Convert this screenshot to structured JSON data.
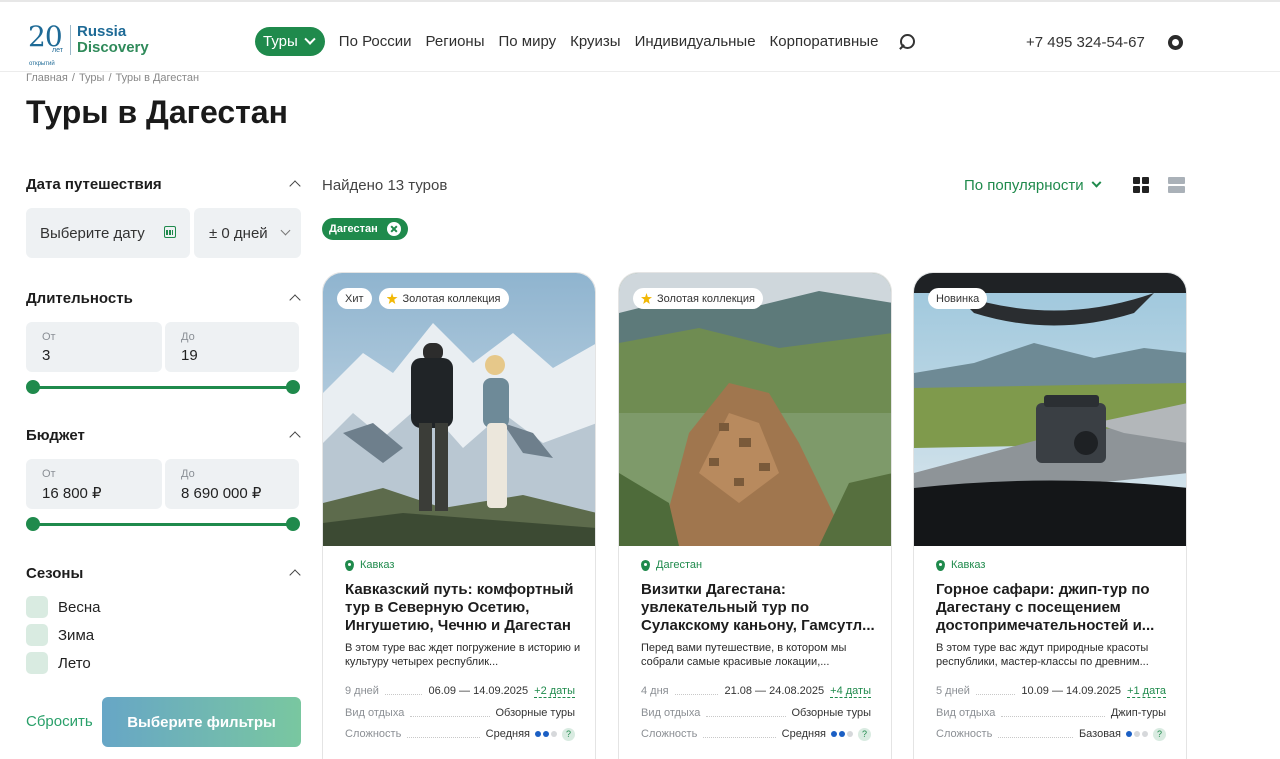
{
  "header": {
    "logo": {
      "years": "20",
      "years_word": "лет",
      "open_word": "открытий",
      "brand_line1": "Russia",
      "brand_line2": "Discovery"
    },
    "nav_primary": "Туры",
    "nav": [
      "По России",
      "Регионы",
      "По миру",
      "Круизы",
      "Индивидуальные",
      "Корпоративные"
    ],
    "phone": "+7 495 324-54-67"
  },
  "breadcrumb": [
    "Главная",
    "/",
    "Туры",
    "/",
    "Туры в Дагестан"
  ],
  "page_title": "Туры в Дагестан",
  "filters": {
    "date_title": "Дата путешествия",
    "date_placeholder": "Выберите дату",
    "days_value": "± 0 дней",
    "duration_title": "Длительность",
    "duration_from_label": "От",
    "duration_from": "3",
    "duration_to_label": "До",
    "duration_to": "19",
    "budget_title": "Бюджет",
    "budget_from_label": "От",
    "budget_from": "16 800 ₽",
    "budget_to_label": "До",
    "budget_to": "8 690 000 ₽",
    "seasons_title": "Сезоны",
    "seasons": [
      "Весна",
      "Зима",
      "Лето"
    ],
    "reset": "Сбросить",
    "apply": "Выберите фильтры"
  },
  "results": {
    "found": "Найдено 13 туров",
    "sort": "По популярности",
    "chip": "Дагестан"
  },
  "cards": [
    {
      "badges": [
        "Хит",
        "Золотая коллекция"
      ],
      "region": "Кавказ",
      "title": "Кавказский путь: комфортный тур в Северную Осетию, Ингушетию, Чечню и Дагестан",
      "desc": "В этом туре вас ждет погружение в историю и культуру четырех республик...",
      "duration": "9 дней",
      "dates": "06.09 — 14.09.2025",
      "more_dates": "+2 даты",
      "rest_label": "Вид отдыха",
      "rest": "Обзорные туры",
      "diff_label": "Сложность",
      "difficulty": "Средняя",
      "difficulty_level": 2
    },
    {
      "badges": [
        "Золотая коллекция"
      ],
      "region": "Дагестан",
      "title": "Визитки Дагестана: увлекательный тур по Сулакскому каньону, Гамсутл...",
      "desc": "Перед вами путешествие, в котором мы собрали самые красивые локации,...",
      "duration": "4 дня",
      "dates": "21.08 — 24.08.2025",
      "more_dates": "+4 даты",
      "rest_label": "Вид отдыха",
      "rest": "Обзорные туры",
      "diff_label": "Сложность",
      "difficulty": "Средняя",
      "difficulty_level": 2
    },
    {
      "badges": [
        "Новинка"
      ],
      "region": "Кавказ",
      "title": "Горное сафари: джип-тур по Дагестану с посещением достопримечательностей и...",
      "desc": "В этом туре вас ждут природные красоты республики, мастер-классы по древним...",
      "duration": "5 дней",
      "dates": "10.09 — 14.09.2025",
      "more_dates": "+1 дата",
      "rest_label": "Вид отдыха",
      "rest": "Джип-туры",
      "diff_label": "Сложность",
      "difficulty": "Базовая",
      "difficulty_level": 1
    }
  ],
  "colors": {
    "accent": "#1f8a4c",
    "logo_blue": "#1e6a96"
  }
}
